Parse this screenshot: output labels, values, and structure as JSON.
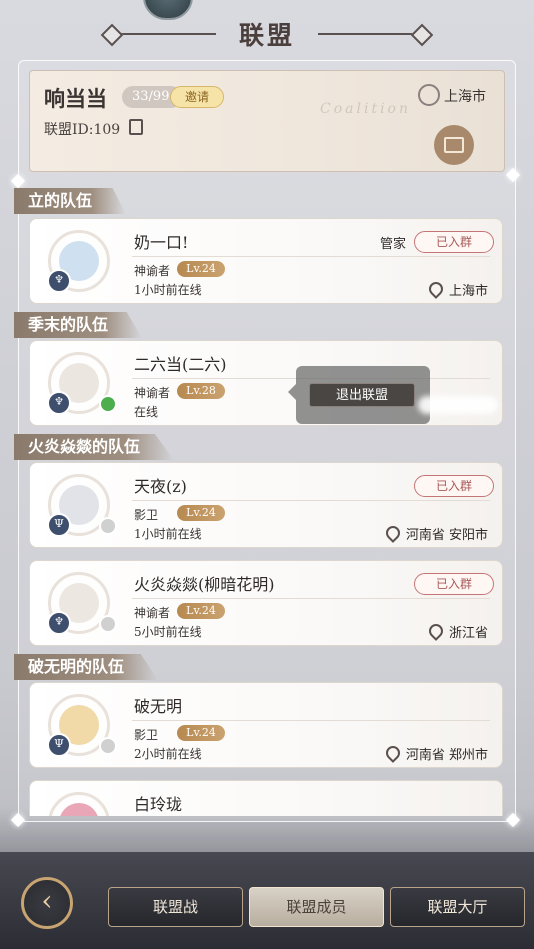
{
  "header": {
    "title": "联盟"
  },
  "alliance": {
    "name": "响当当",
    "member_count": "33/99",
    "invite_label": "邀请",
    "id_label": "联盟ID:109",
    "watermark": "Coalition",
    "location": "上海市"
  },
  "teams": [
    {
      "name": "立的队伍",
      "members": [
        {
          "name": "奶一口!",
          "role": "神谕者",
          "level": "Lv.24",
          "last_online": "1小时前在线",
          "location": "上海市",
          "title": "管家",
          "group_status": "已入群"
        }
      ]
    },
    {
      "name": "季末的队伍",
      "members": [
        {
          "name": "二六当(二六)",
          "role": "神谕者",
          "level": "Lv.28",
          "last_online": "在线"
        }
      ]
    },
    {
      "name": "火炎焱燚的队伍",
      "members": [
        {
          "name": "天夜(z)",
          "role": "影卫",
          "level": "Lv.24",
          "last_online": "1小时前在线",
          "location": "河南省 安阳市",
          "group_status": "已入群"
        },
        {
          "name": "火炎焱燚(柳暗花明)",
          "role": "神谕者",
          "level": "Lv.24",
          "last_online": "5小时前在线",
          "location": "浙江省",
          "group_status": "已入群"
        }
      ]
    },
    {
      "name": "破无明的队伍",
      "members": [
        {
          "name": "破无明",
          "role": "影卫",
          "level": "Lv.24",
          "last_online": "2小时前在线",
          "location": "河南省 郑州市"
        },
        {
          "name": "白玲珑"
        }
      ]
    }
  ],
  "popup": {
    "exit_label": "退出联盟"
  },
  "bottom_tabs": [
    "联盟战",
    "联盟成员",
    "联盟大厅"
  ],
  "active_tab": "联盟成员",
  "icons": [
    "back-arrow-icon",
    "location-pin-icon",
    "copy-icon",
    "gift-icon",
    "class-icon",
    "status-icon"
  ],
  "colors": {
    "accent_gold": "#b6894f",
    "joined_red": "#c47575",
    "background": "#d9dadf"
  }
}
